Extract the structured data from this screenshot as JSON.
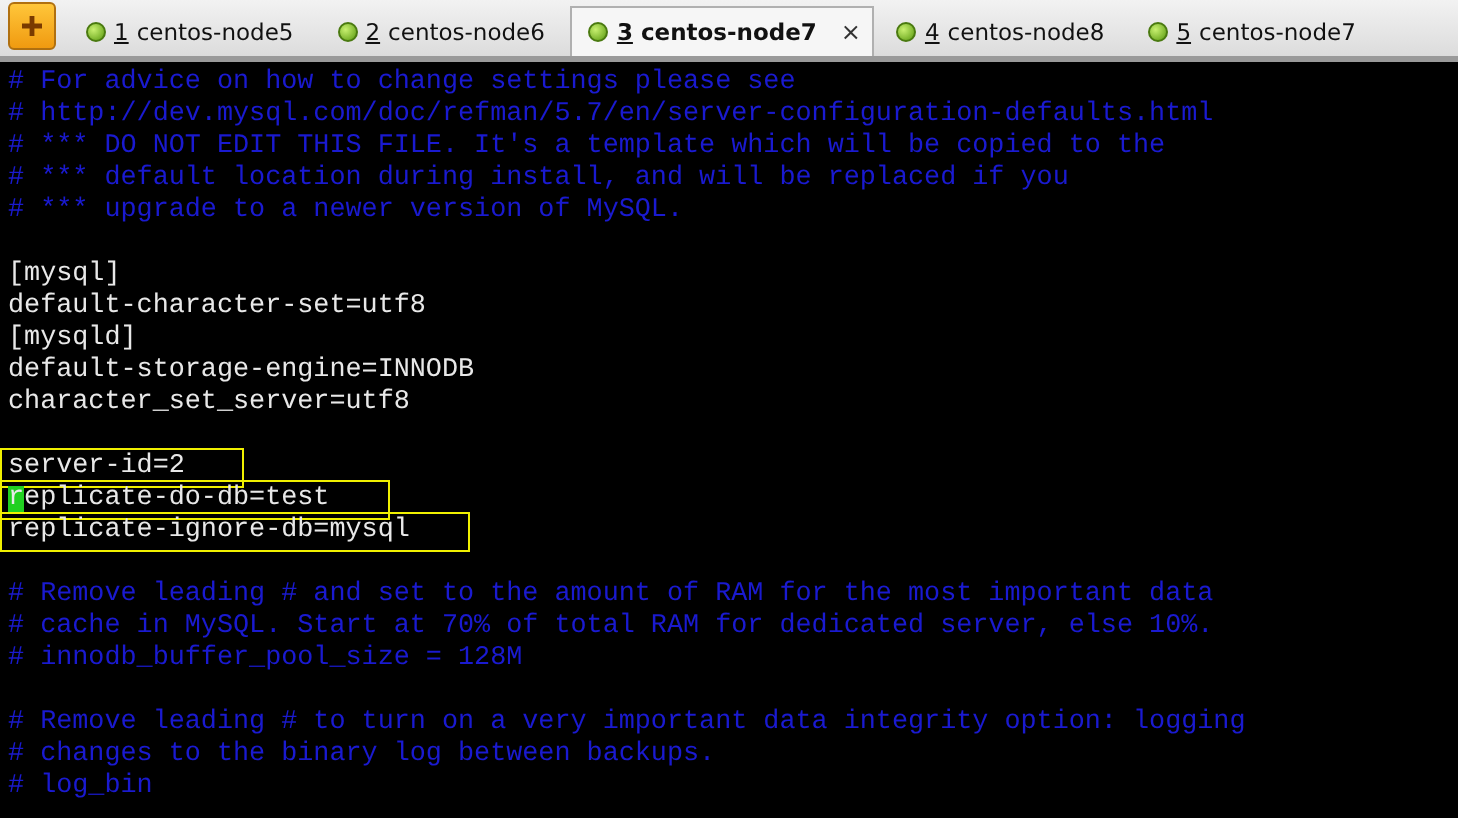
{
  "tabs": [
    {
      "number": "1",
      "label": "centos-node5",
      "selected": false
    },
    {
      "number": "2",
      "label": "centos-node6",
      "selected": false
    },
    {
      "number": "3",
      "label": "centos-node7",
      "selected": true
    },
    {
      "number": "4",
      "label": "centos-node8",
      "selected": false
    },
    {
      "number": "5",
      "label": "centos-node7",
      "selected": false
    }
  ],
  "close_glyph": "×",
  "terminal": {
    "lines": [
      {
        "kind": "comment",
        "text": "# For advice on how to change settings please see"
      },
      {
        "kind": "comment",
        "text": "# http://dev.mysql.com/doc/refman/5.7/en/server-configuration-defaults.html"
      },
      {
        "kind": "comment",
        "text": "# *** DO NOT EDIT THIS FILE. It's a template which will be copied to the"
      },
      {
        "kind": "comment",
        "text": "# *** default location during install, and will be replaced if you"
      },
      {
        "kind": "comment",
        "text": "# *** upgrade to a newer version of MySQL."
      },
      {
        "kind": "blank"
      },
      {
        "kind": "setting",
        "text": "[mysql]",
        "boxed": false,
        "cursor": false
      },
      {
        "kind": "setting",
        "text": "default-character-set=utf8",
        "boxed": false,
        "cursor": false
      },
      {
        "kind": "setting",
        "text": "[mysqld]",
        "boxed": false,
        "cursor": false
      },
      {
        "kind": "setting",
        "text": "default-storage-engine=INNODB",
        "boxed": false,
        "cursor": false
      },
      {
        "kind": "setting",
        "text": "character_set_server=utf8",
        "boxed": false,
        "cursor": false
      },
      {
        "kind": "blank"
      },
      {
        "kind": "setting",
        "text": "server-id=2",
        "boxed": true,
        "cursor": false
      },
      {
        "kind": "setting",
        "text": "replicate-do-db=test",
        "boxed": true,
        "cursor": true
      },
      {
        "kind": "setting",
        "text": "replicate-ignore-db=mysql",
        "boxed": true,
        "cursor": false
      },
      {
        "kind": "blank"
      },
      {
        "kind": "comment",
        "text": "# Remove leading # and set to the amount of RAM for the most important data"
      },
      {
        "kind": "comment",
        "text": "# cache in MySQL. Start at 70% of total RAM for dedicated server, else 10%."
      },
      {
        "kind": "comment",
        "text": "# innodb_buffer_pool_size = 128M"
      },
      {
        "kind": "blank"
      },
      {
        "kind": "comment",
        "text": "# Remove leading # to turn on a very important data integrity option: logging"
      },
      {
        "kind": "comment",
        "text": "# changes to the binary log between backups."
      },
      {
        "kind": "comment",
        "text": "# log_bin"
      }
    ]
  }
}
